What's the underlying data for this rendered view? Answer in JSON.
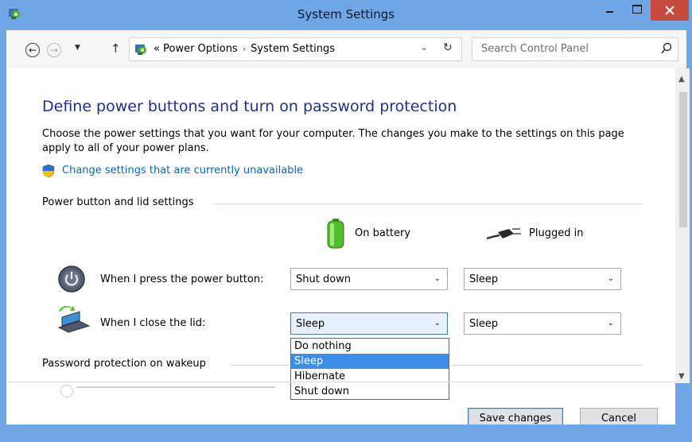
{
  "window": {
    "title": "System Settings"
  },
  "nav": {
    "breadcrumb_prefix": "«",
    "breadcrumb": [
      "Power Options",
      "System Settings"
    ],
    "breadcrumb_separator": "›",
    "search_placeholder": "Search Control Panel"
  },
  "page": {
    "title": "Define power buttons and turn on password protection",
    "description": "Choose the power settings that you want for your computer. The changes you make to the settings on this page apply to all of your power plans.",
    "change_link": "Change settings that are currently unavailable"
  },
  "power_section": {
    "heading": "Power button and lid settings",
    "col_battery": "On battery",
    "col_plugged": "Plugged in",
    "rows": [
      {
        "label": "When I press the power button:",
        "battery": "Shut down",
        "plugged": "Sleep"
      },
      {
        "label": "When I close the lid:",
        "battery": "Sleep",
        "plugged": "Sleep"
      }
    ]
  },
  "dropdown": {
    "options": [
      "Do nothing",
      "Sleep",
      "Hibernate",
      "Shut down"
    ],
    "selected": "Sleep"
  },
  "password_section": {
    "heading": "Password protection on wakeup"
  },
  "footer": {
    "save_label": "Save changes",
    "cancel_label": "Cancel"
  },
  "colors": {
    "title_bar": "#6ea6e6",
    "close_button": "#c74a3f",
    "heading_text": "#1e3287",
    "link": "#0066cc",
    "selection": "#3d8ee6"
  },
  "icons": [
    "control-panel-icon",
    "back-arrow-icon",
    "forward-arrow-icon",
    "up-arrow-icon",
    "refresh-icon",
    "search-icon",
    "shield-icon",
    "battery-icon",
    "plug-icon",
    "power-button-icon",
    "laptop-lid-icon",
    "chevron-down-icon"
  ]
}
